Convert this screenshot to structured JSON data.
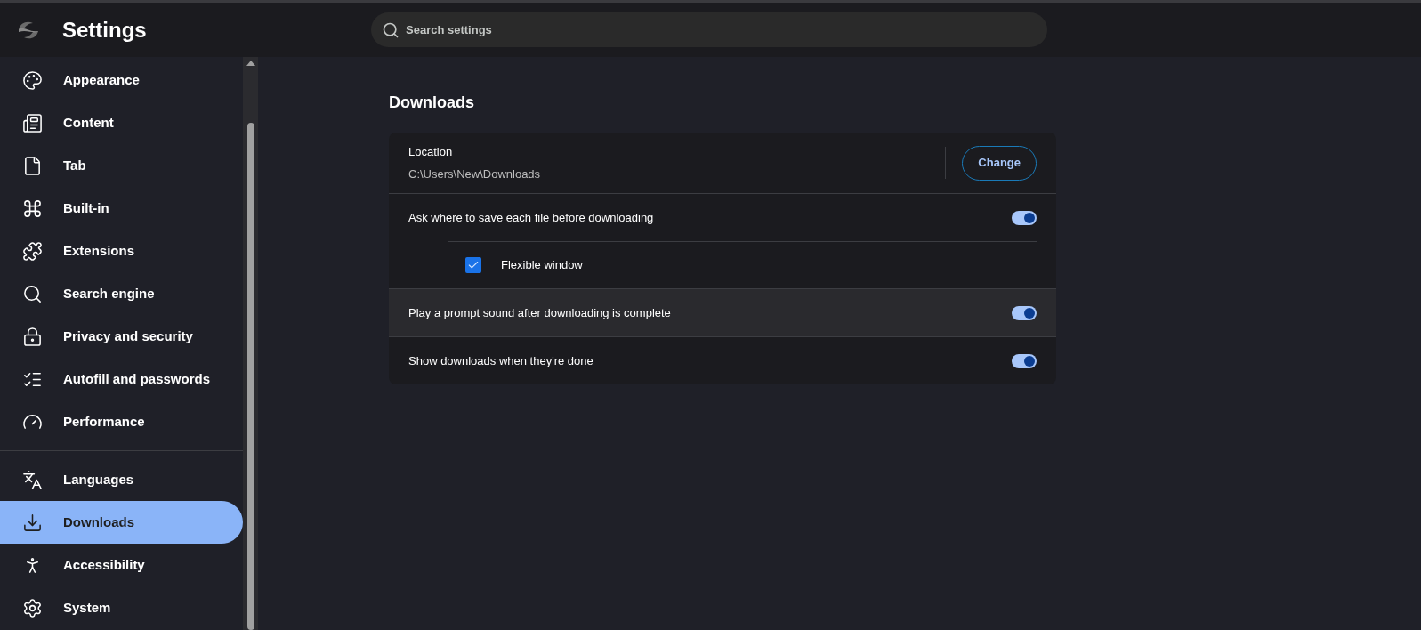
{
  "header": {
    "title": "Settings",
    "search": {
      "placeholder": "Search settings"
    }
  },
  "sidebar": {
    "groups": [
      [
        {
          "label": "Appearance",
          "selected": false
        },
        {
          "label": "Content",
          "selected": false
        },
        {
          "label": "Tab",
          "selected": false
        },
        {
          "label": "Built-in",
          "selected": false
        },
        {
          "label": "Extensions",
          "selected": false
        },
        {
          "label": "Search engine",
          "selected": false
        },
        {
          "label": "Privacy and security",
          "selected": false
        },
        {
          "label": "Autofill and passwords",
          "selected": false
        },
        {
          "label": "Performance",
          "selected": false
        }
      ],
      [
        {
          "label": "Languages",
          "selected": false
        },
        {
          "label": "Downloads",
          "selected": true
        },
        {
          "label": "Accessibility",
          "selected": false
        },
        {
          "label": "System",
          "selected": false
        }
      ]
    ]
  },
  "section": {
    "title": "Downloads",
    "location": {
      "label": "Location",
      "path": "C:\\Users\\New\\Downloads",
      "button": "Change"
    },
    "settings": [
      {
        "label": "Ask where to save each file before downloading",
        "on": true,
        "highlighted": false,
        "children": [
          {
            "label": "Flexible window",
            "checked": true
          }
        ]
      },
      {
        "label": "Play a prompt sound after downloading is complete",
        "on": true,
        "highlighted": true
      },
      {
        "label": "Show downloads when they're done",
        "on": true,
        "highlighted": false
      }
    ]
  }
}
